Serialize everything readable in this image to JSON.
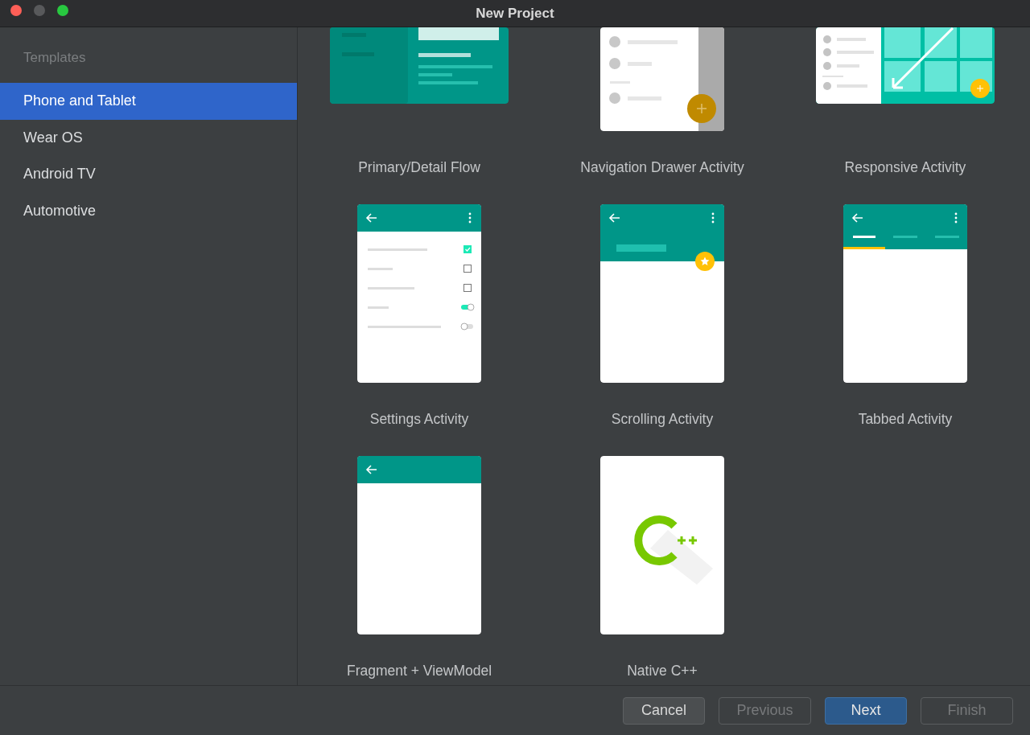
{
  "window": {
    "title": "New Project"
  },
  "sidebar": {
    "header": "Templates",
    "items": [
      {
        "label": "Phone and Tablet",
        "selected": true
      },
      {
        "label": "Wear OS",
        "selected": false
      },
      {
        "label": "Android TV",
        "selected": false
      },
      {
        "label": "Automotive",
        "selected": false
      }
    ]
  },
  "templates": [
    {
      "name": "Primary/Detail Flow",
      "kind": "primary-detail"
    },
    {
      "name": "Navigation Drawer Activity",
      "kind": "nav-drawer"
    },
    {
      "name": "Responsive Activity",
      "kind": "responsive"
    },
    {
      "name": "Settings Activity",
      "kind": "settings"
    },
    {
      "name": "Scrolling Activity",
      "kind": "scrolling"
    },
    {
      "name": "Tabbed Activity",
      "kind": "tabbed"
    },
    {
      "name": "Fragment + ViewModel",
      "kind": "basic"
    },
    {
      "name": "Native C++",
      "kind": "cpp"
    }
  ],
  "buttons": [
    {
      "label": "Cancel",
      "kind": "secondary",
      "disabled": false
    },
    {
      "label": "Previous",
      "kind": "secondary",
      "disabled": true
    },
    {
      "label": "Next",
      "kind": "primary",
      "disabled": false
    },
    {
      "label": "Finish",
      "kind": "secondary",
      "disabled": true
    }
  ]
}
